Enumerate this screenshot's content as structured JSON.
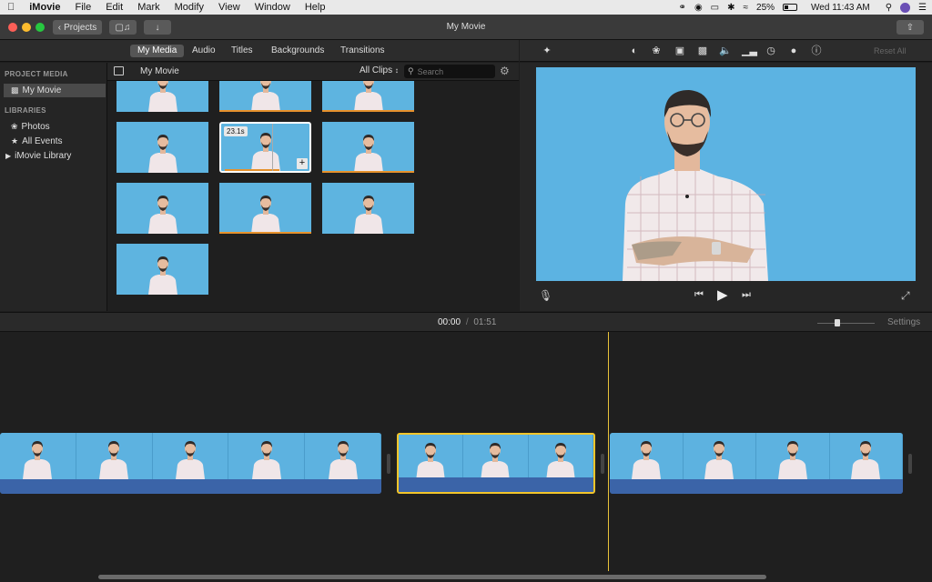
{
  "menubar": {
    "app": "iMovie",
    "items": [
      "File",
      "Edit",
      "Mark",
      "Modify",
      "View",
      "Window",
      "Help"
    ],
    "battery": "25%",
    "clock": "Wed 11:43 AM"
  },
  "titlebar": {
    "projects_label": "Projects",
    "title": "My Movie"
  },
  "media_tabs": [
    "My Media",
    "Audio",
    "Titles",
    "Backgrounds",
    "Transitions"
  ],
  "viewer_toolbar": {
    "reset_all": "Reset All"
  },
  "sidebar": {
    "project_media_header": "PROJECT MEDIA",
    "project_item": "My Movie",
    "libraries_header": "LIBRARIES",
    "photos": "Photos",
    "all_events": "All Events",
    "imovie_library": "iMovie Library"
  },
  "browser": {
    "title": "My Movie",
    "filter": "All Clips",
    "search_placeholder": "Search",
    "selected_duration": "23.1s"
  },
  "timeline": {
    "current_time": "00:00",
    "separator": "/",
    "total_time": "01:51",
    "settings": "Settings"
  },
  "colors": {
    "accent_selection": "#f2c52a",
    "background_blue": "#5cb3e2",
    "audio_wave": "#3b64a8"
  }
}
